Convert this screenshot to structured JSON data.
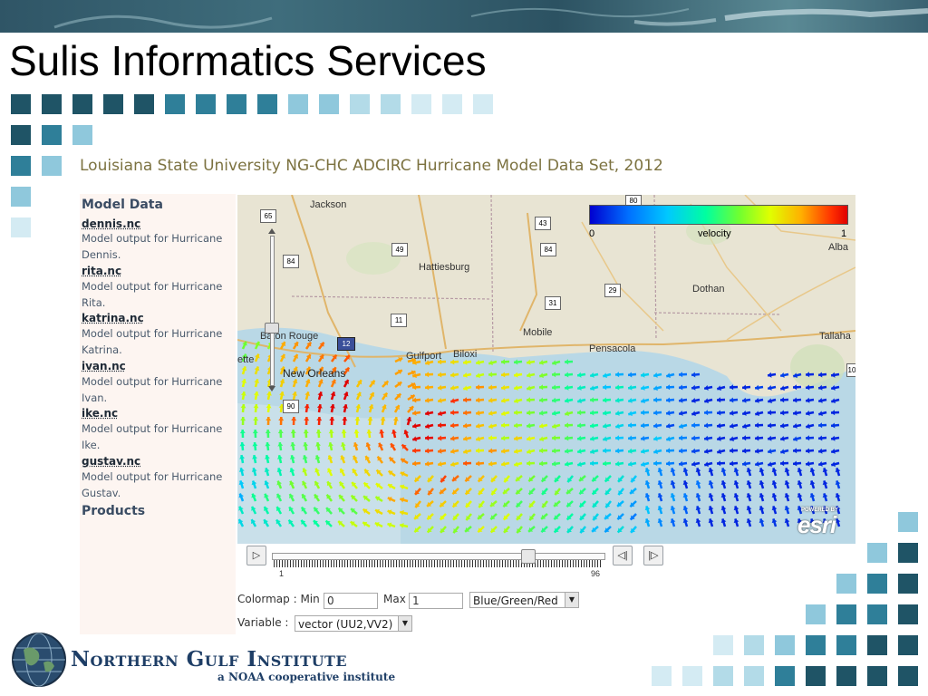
{
  "slide": {
    "title": "Sulis Informatics Services"
  },
  "page": {
    "heading": "Louisiana State University NG-CHC ADCIRC Hurricane Model Data Set, 2012"
  },
  "sidebar": {
    "model_data_title": "Model Data",
    "items": [
      {
        "name": "dennis.nc",
        "desc": "Model output for Hurricane Dennis."
      },
      {
        "name": "rita.nc",
        "desc": "Model output for Hurricane Rita."
      },
      {
        "name": "katrina.nc",
        "desc": "Model output for Hurricane Katrina."
      },
      {
        "name": "ivan.nc",
        "desc": "Model output for Hurricane Ivan."
      },
      {
        "name": "ike.nc",
        "desc": "Model output for Hurricane Ike."
      },
      {
        "name": "gustav.nc",
        "desc": "Model output for Hurricane Gustav."
      }
    ],
    "products_title": "Products"
  },
  "map": {
    "legend": {
      "min": "0",
      "label": "velocity",
      "max": "1"
    },
    "powered_by": "POWERED BY",
    "esri": "esri",
    "places": {
      "jackson": "Jackson",
      "hattiesburg": "Hattiesburg",
      "mobile": "Mobile",
      "pensacola": "Pensacola",
      "dothan": "Dothan",
      "tallahassee": "Tallaha",
      "albany": "Alba",
      "baton_rouge": "Baton Rouge",
      "new_orleans": "New Orleans",
      "gulfport": "Gulfport",
      "biloxi": "Biloxi",
      "lafayette": "ette"
    },
    "shields": {
      "s65": "65",
      "s84a": "84",
      "s43": "43",
      "s49": "49",
      "s84b": "84",
      "s29": "29",
      "s31": "31",
      "s11": "11",
      "s12": "12",
      "s10": "10",
      "s90": "90",
      "s80": "80"
    }
  },
  "timebar": {
    "start": "1",
    "end": "96",
    "position": 0.77
  },
  "controls": {
    "colormap_label": "Colormap : Min",
    "min_value": "0",
    "max_label": "Max",
    "max_value": "1",
    "colormap_option": "Blue/Green/Red",
    "variable_label": "Variable :",
    "variable_option": "vector (UU2,VV2)"
  },
  "footer": {
    "institute": "Northern Gulf Institute",
    "subtitle": "a NOAA cooperative institute"
  },
  "colors": {
    "accent_dark": "#1f5466",
    "accent_mid": "#2f7f99",
    "accent_light": "#8fc8dc",
    "accent_pale": "#d4ebf3"
  }
}
